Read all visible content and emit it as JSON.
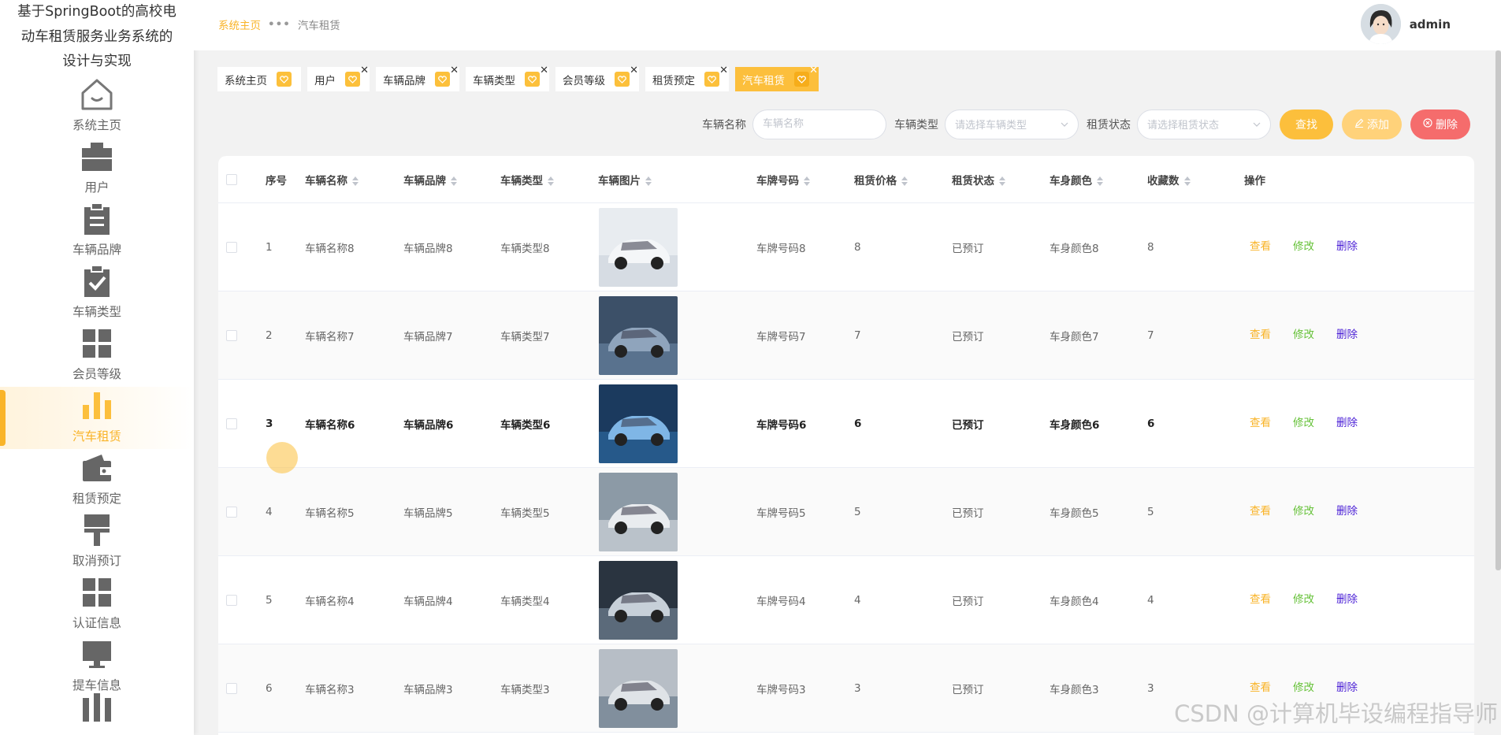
{
  "app": {
    "title_line1": "基于SpringBoot的高校电",
    "title_line2": "动车租赁服务业务系统的",
    "title_line3": "设计与实现"
  },
  "sidebar": {
    "items": [
      {
        "label": "系统主页",
        "icon": "home-icon"
      },
      {
        "label": "用户",
        "icon": "briefcase-icon"
      },
      {
        "label": "车辆品牌",
        "icon": "clipboard-icon"
      },
      {
        "label": "车辆类型",
        "icon": "clipboard-check-icon"
      },
      {
        "label": "会员等级",
        "icon": "grid-icon"
      },
      {
        "label": "汽车租赁",
        "icon": "bar-chart-icon"
      },
      {
        "label": "租赁预定",
        "icon": "wallet-icon"
      },
      {
        "label": "取消预订",
        "icon": "brush-icon"
      },
      {
        "label": "认证信息",
        "icon": "grid-icon"
      },
      {
        "label": "提车信息",
        "icon": "monitor-icon"
      }
    ],
    "active_index": 5
  },
  "header": {
    "breadcrumb_home": "系统主页",
    "breadcrumb_sep": "•••",
    "breadcrumb_current": "汽车租赁",
    "username": "admin"
  },
  "tags": [
    {
      "label": "系统主页",
      "closable": false
    },
    {
      "label": "用户",
      "closable": true
    },
    {
      "label": "车辆品牌",
      "closable": true
    },
    {
      "label": "车辆类型",
      "closable": true
    },
    {
      "label": "会员等级",
      "closable": true
    },
    {
      "label": "租赁预定",
      "closable": true
    },
    {
      "label": "汽车租赁",
      "closable": true,
      "active": true
    }
  ],
  "search": {
    "name_label": "车辆名称",
    "name_placeholder": "车辆名称",
    "type_label": "车辆类型",
    "type_placeholder": "请选择车辆类型",
    "status_label": "租赁状态",
    "status_placeholder": "请选择租赁状态",
    "find_label": "查找",
    "add_label": "添加",
    "delete_label": "删除"
  },
  "table": {
    "headers": {
      "index": "序号",
      "name": "车辆名称",
      "brand": "车辆品牌",
      "type": "车辆类型",
      "image": "车辆图片",
      "plate": "车牌号码",
      "price": "租赁价格",
      "status": "租赁状态",
      "color": "车身颜色",
      "fav": "收藏数",
      "ops": "操作"
    },
    "ops": {
      "view": "查看",
      "edit": "修改",
      "delete": "删除"
    },
    "rows": [
      {
        "index": "1",
        "name": "车辆名称8",
        "brand": "车辆品牌8",
        "type": "车辆类型8",
        "plate": "车牌号码8",
        "price": "8",
        "status": "已预订",
        "color": "车身颜色8",
        "fav": "8"
      },
      {
        "index": "2",
        "name": "车辆名称7",
        "brand": "车辆品牌7",
        "type": "车辆类型7",
        "plate": "车牌号码7",
        "price": "7",
        "status": "已预订",
        "color": "车身颜色7",
        "fav": "7"
      },
      {
        "index": "3",
        "name": "车辆名称6",
        "brand": "车辆品牌6",
        "type": "车辆类型6",
        "plate": "车牌号码6",
        "price": "6",
        "status": "已预订",
        "color": "车身颜色6",
        "fav": "6"
      },
      {
        "index": "4",
        "name": "车辆名称5",
        "brand": "车辆品牌5",
        "type": "车辆类型5",
        "plate": "车牌号码5",
        "price": "5",
        "status": "已预订",
        "color": "车身颜色5",
        "fav": "5"
      },
      {
        "index": "5",
        "name": "车辆名称4",
        "brand": "车辆品牌4",
        "type": "车辆类型4",
        "plate": "车牌号码4",
        "price": "4",
        "status": "已预订",
        "color": "车身颜色4",
        "fav": "4"
      },
      {
        "index": "6",
        "name": "车辆名称3",
        "brand": "车辆品牌3",
        "type": "车辆类型3",
        "plate": "车牌号码3",
        "price": "3",
        "status": "已预订",
        "color": "车身颜色3",
        "fav": "3"
      }
    ]
  },
  "watermark": "CSDN @计算机毕设编程指导师",
  "colors": {
    "accent": "#fcbf3c",
    "danger": "#f56c6c",
    "edit": "#67c23a",
    "delete_link": "#4a1fd6"
  }
}
